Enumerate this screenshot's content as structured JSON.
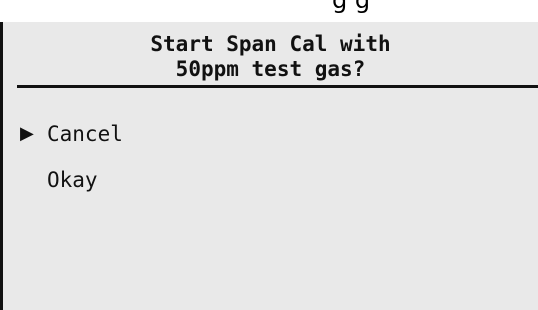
{
  "partial_text_above": "g g",
  "header": {
    "line1": "Start Span Cal with",
    "line2": "50ppm test gas?"
  },
  "menu": {
    "selected_index": 0,
    "pointer_icon": "triangle-right-icon",
    "items": [
      {
        "label": "Cancel"
      },
      {
        "label": "Okay"
      }
    ]
  }
}
